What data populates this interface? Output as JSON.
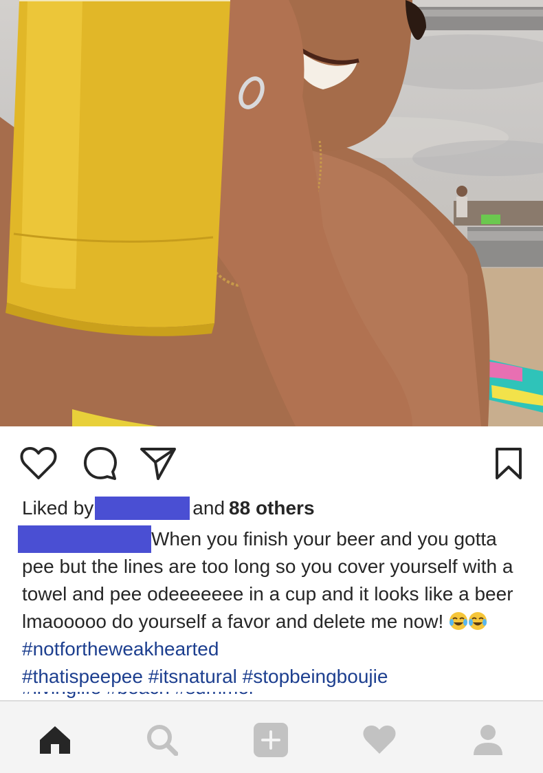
{
  "post": {
    "liked_prefix": "Liked by",
    "liked_suffix": "and",
    "liked_count_text": "88 others",
    "caption_text": "When you finish your beer and you gotta pee but the lines are too long so you cover yourself with a towel and pee odeeeeeee in a cup and it looks like a beer lmaooooo do yourself a favor and delete me now!",
    "hashtags_line1": "#notfortheweakhearted",
    "hashtags_line2": "#thatispeepee #itsnatural #stopbeingboujie",
    "hashtags_cut": "#livinglife #beach #summer",
    "emoji": [
      "crying-laughing-emoji",
      "crying-laughing-emoji"
    ]
  },
  "actions": [
    "heart-icon",
    "comment-icon",
    "share-icon",
    "bookmark-icon"
  ],
  "bottom_nav": [
    "home-icon",
    "search-icon",
    "add-post-icon",
    "activity-heart-icon",
    "profile-icon"
  ],
  "colors": {
    "redaction": "#4a4fd3",
    "hashtag": "#1d3f8f",
    "text": "#262626",
    "nav_bg": "#f4f4f4",
    "nav_inactive": "#c2c2c2",
    "nav_active": "#262626"
  }
}
